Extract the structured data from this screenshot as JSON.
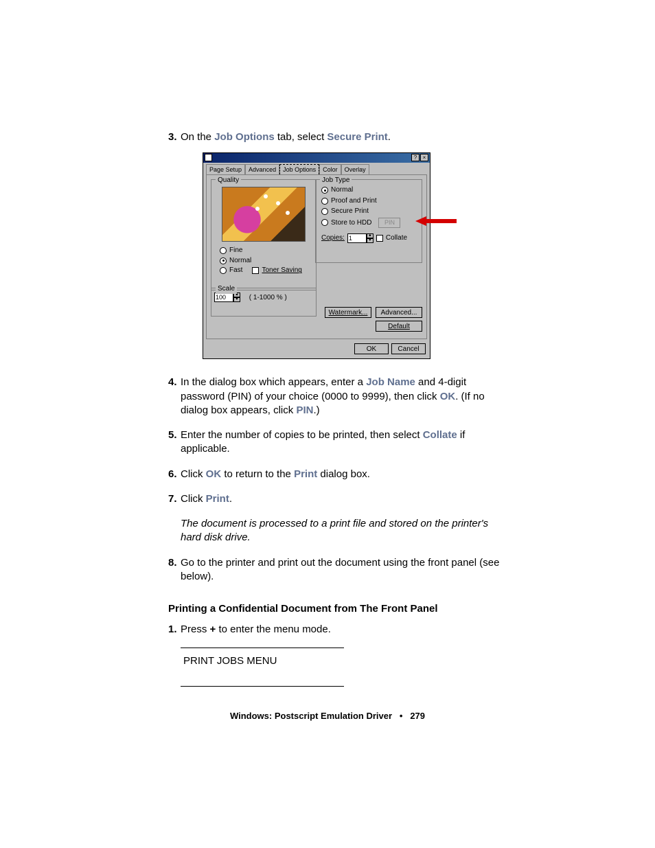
{
  "steps": {
    "s3_pre": "On the ",
    "s3_b1": "Job Options",
    "s3_mid": " tab, select ",
    "s3_b2": "Secure Print",
    "s3_post": ".",
    "s4_a": "In the dialog box which appears, enter a ",
    "s4_b1": "Job Name",
    "s4_b": " and 4-digit password (PIN) of your choice (0000 to 9999), then click ",
    "s4_b2": "OK",
    "s4_c": ". (If no dialog box appears, click ",
    "s4_b3": "PIN",
    "s4_d": ".)",
    "s5_a": "Enter the number of copies to be printed, then select ",
    "s5_b1": "Collate",
    "s5_b": " if applicable.",
    "s6_a": "Click ",
    "s6_b1": "OK",
    "s6_b": " to return to the ",
    "s6_b2": "Print",
    "s6_c": " dialog box.",
    "s7_a": "Click ",
    "s7_b1": "Print",
    "s7_b": ".",
    "s7_note": "The document is processed to a print file and stored on the printer's hard disk drive.",
    "s8": "Go to the printer and print out the document using the front panel (see below).",
    "sec2": "Printing a Confidential Document from The Front Panel",
    "sec2_s1_a": "Press ",
    "sec2_s1_b": "+",
    "sec2_s1_c": " to enter the menu mode.",
    "menu_line": "PRINT JOBS MENU"
  },
  "footer": {
    "left": "Windows: Postscript Emulation Driver",
    "sep": "•",
    "page": "279"
  },
  "dialog": {
    "tabs": {
      "t1": "Page Setup",
      "t2": "Advanced",
      "t3": "Job Options",
      "t4": "Color",
      "t5": "Overlay"
    },
    "quality": {
      "label": "Quality",
      "fine": "Fine",
      "normal": "Normal",
      "fast": "Fast",
      "toner": "Toner Saving"
    },
    "scale": {
      "label": "Scale",
      "value": "100",
      "range": "( 1-1000 % )"
    },
    "jobtype": {
      "label": "Job Type",
      "normal": "Normal",
      "proof": "Proof and Print",
      "secure": "Secure Print",
      "store": "Store to HDD",
      "pin": "PIN"
    },
    "copies": {
      "label": "Copies:",
      "value": "1",
      "collate": "Collate"
    },
    "buttons": {
      "watermark": "Watermark...",
      "advanced": "Advanced...",
      "default": "Default",
      "ok": "OK",
      "cancel": "Cancel"
    },
    "titlebtns": {
      "help": "?",
      "close": "×"
    }
  }
}
